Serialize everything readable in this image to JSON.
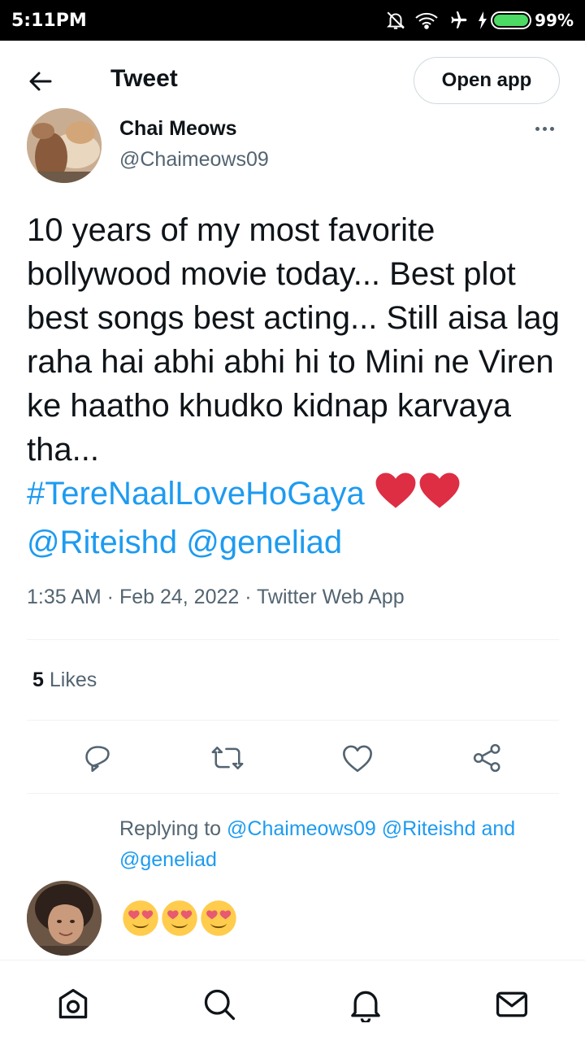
{
  "status_bar": {
    "time": "5:11PM",
    "battery_percent": "99%",
    "battery_level": 0.99,
    "icons": [
      "notifications-off-icon",
      "wifi-icon",
      "airplane-icon",
      "charging-bolt-icon",
      "battery-icon"
    ]
  },
  "header": {
    "back_icon": "back-arrow-icon",
    "title": "Tweet",
    "open_app_label": "Open app"
  },
  "tweet": {
    "author_name": "Chai Meows",
    "author_handle": "@Chaimeows09",
    "text": "10 years of my most favorite bollywood movie today... Best plot best songs best acting... Still aisa lag raha hai abhi abhi hi to Mini ne Viren ke haatho khudko kidnap karvaya tha...",
    "hashtag": "#TereNaalLoveHoGaya",
    "emojis": [
      "red-heart",
      "red-heart"
    ],
    "mention_1": "@Riteishd",
    "mention_2": "@geneliad",
    "timestamp": "1:35 AM · Feb 24, 2022 · Twitter Web App",
    "likes_count": "5",
    "likes_label": "Likes",
    "actions": [
      "reply-icon",
      "retweet-icon",
      "like-icon",
      "share-icon"
    ]
  },
  "reply": {
    "replying_prefix": "Replying to",
    "replying_handle_1": "@Chaimeows09",
    "replying_handle_2": "@Riteishd",
    "replying_and": "and",
    "replying_handle_3": "@geneliad",
    "emojis": [
      "heart-eyes",
      "heart-eyes",
      "heart-eyes"
    ]
  },
  "bottom_nav": {
    "items": [
      "home-icon",
      "search-icon",
      "notifications-icon",
      "messages-icon"
    ]
  },
  "colors": {
    "link": "#1d9bf0",
    "secondary_text": "#536471",
    "heart_red": "#dd2e44",
    "battery_green": "#4cd964"
  }
}
